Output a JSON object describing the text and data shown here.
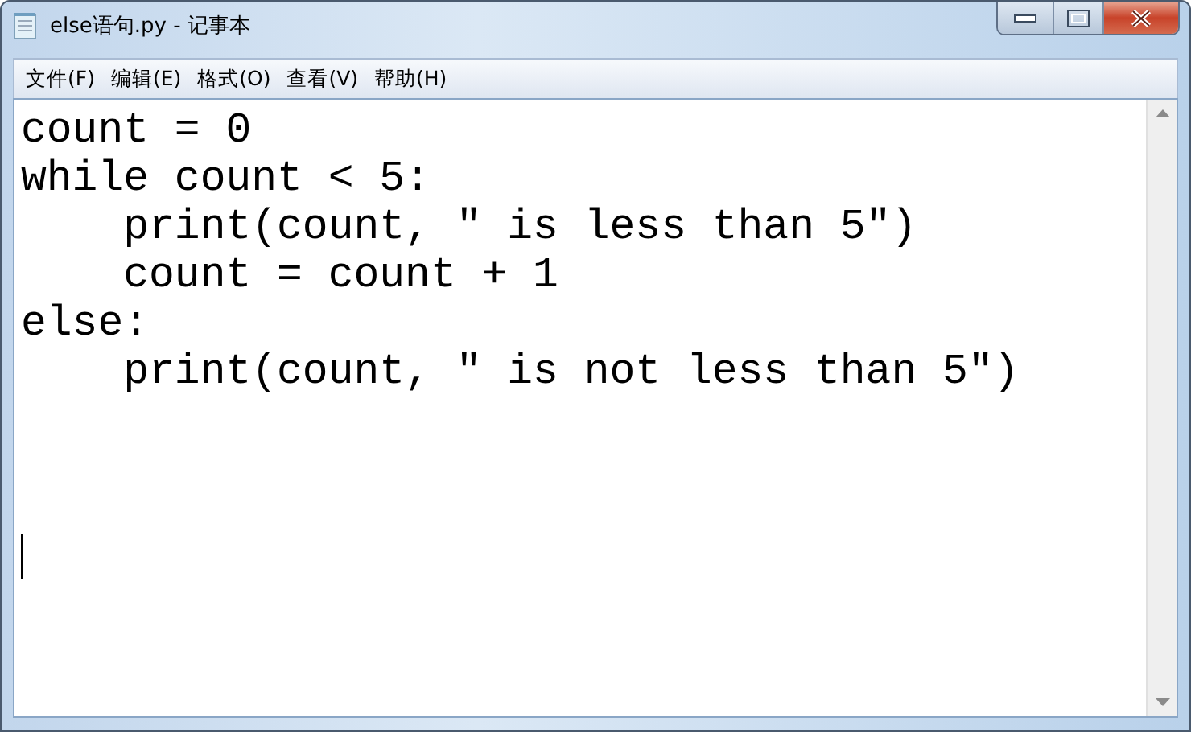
{
  "window": {
    "title": "else语句.py - 记事本"
  },
  "menu": [
    "文件(F)",
    "编辑(E)",
    "格式(O)",
    "查看(V)",
    "帮助(H)"
  ],
  "editor": {
    "lines": [
      "count = 0",
      "while count < 5:",
      "    print(count, ″ is less than 5″)",
      "    count = count + 1",
      "else:",
      "    print(count, ″ is not less than 5″)"
    ]
  }
}
